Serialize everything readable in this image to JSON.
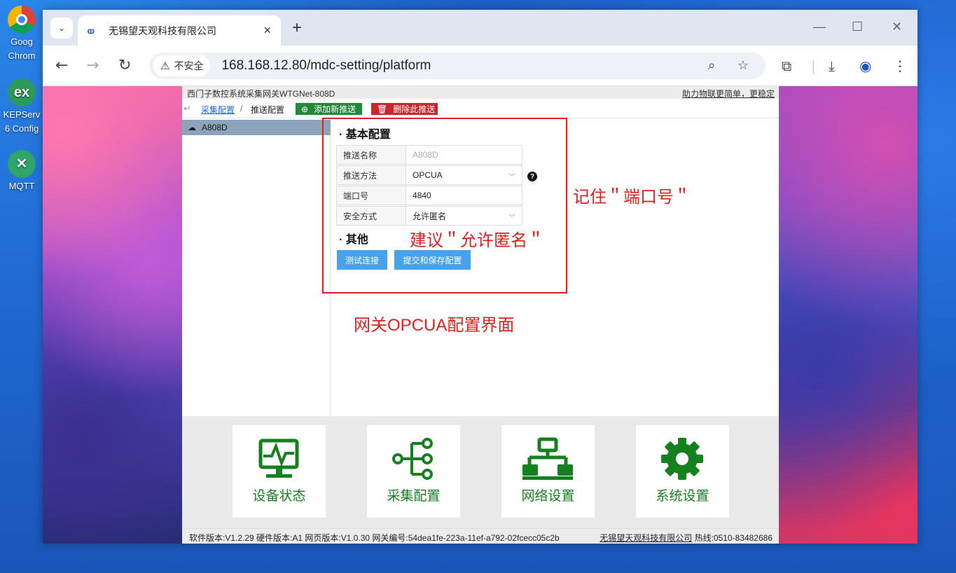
{
  "desktop": {
    "icons": [
      {
        "label": "Goog",
        "label2": "Chrom"
      },
      {
        "label": "KEPServ",
        "label2": "6 Config"
      },
      {
        "label": "MQTT",
        "label2": ""
      }
    ]
  },
  "browser": {
    "tab_title": "无锡望天观科技有限公司",
    "security_label": "不安全",
    "url": "168.168.12.80/mdc-setting/platform"
  },
  "app": {
    "header_title": "西门子数控系统采集网关WTGNet-808D",
    "slogan": "助力物联更简单，更稳定",
    "breadcrumb": {
      "root": "采集配置",
      "separator": "/",
      "current": "推送配置"
    },
    "buttons": {
      "add_push": "添加新推送",
      "delete_push": "删除此推送",
      "test_connection": "测试连接",
      "submit_save": "提交和保存配置"
    },
    "sidebar": {
      "items": [
        {
          "label": "A808D",
          "selected": true
        }
      ]
    },
    "form": {
      "basic_title": "· 基本配置",
      "other_title": "· 其他",
      "fields": [
        {
          "label": "推送名称",
          "value": "A808D",
          "disabled": true
        },
        {
          "label": "推送方法",
          "value": "OPCUA",
          "type": "select"
        },
        {
          "label": "端口号",
          "value": "4840"
        },
        {
          "label": "安全方式",
          "value": "允许匿名",
          "type": "select"
        }
      ]
    },
    "annotations": {
      "port_note": "记住＂端口号＂",
      "security_note": "建议＂允许匿名＂",
      "caption": "网关OPCUA配置界面"
    },
    "dock": [
      {
        "label": "设备状态",
        "icon": "monitor-pulse-icon"
      },
      {
        "label": "采集配置",
        "icon": "node-tree-icon"
      },
      {
        "label": "网络设置",
        "icon": "network-icon"
      },
      {
        "label": "系统设置",
        "icon": "gear-icon"
      }
    ],
    "footer": {
      "versions": "软件版本:V1.2.29  硬件版本:A1  网页版本:V1.0.30  网关编号:54dea1fe-223a-11ef-a792-02fcecc05c2b",
      "company": "无锡望天观科技有限公司",
      "hotline": "热线:0510-83482686"
    },
    "colors": {
      "accent_green": "#16801f",
      "delete_red": "#c9262c",
      "primary_blue": "#46a2ec",
      "annotation_red": "#e02020"
    }
  }
}
